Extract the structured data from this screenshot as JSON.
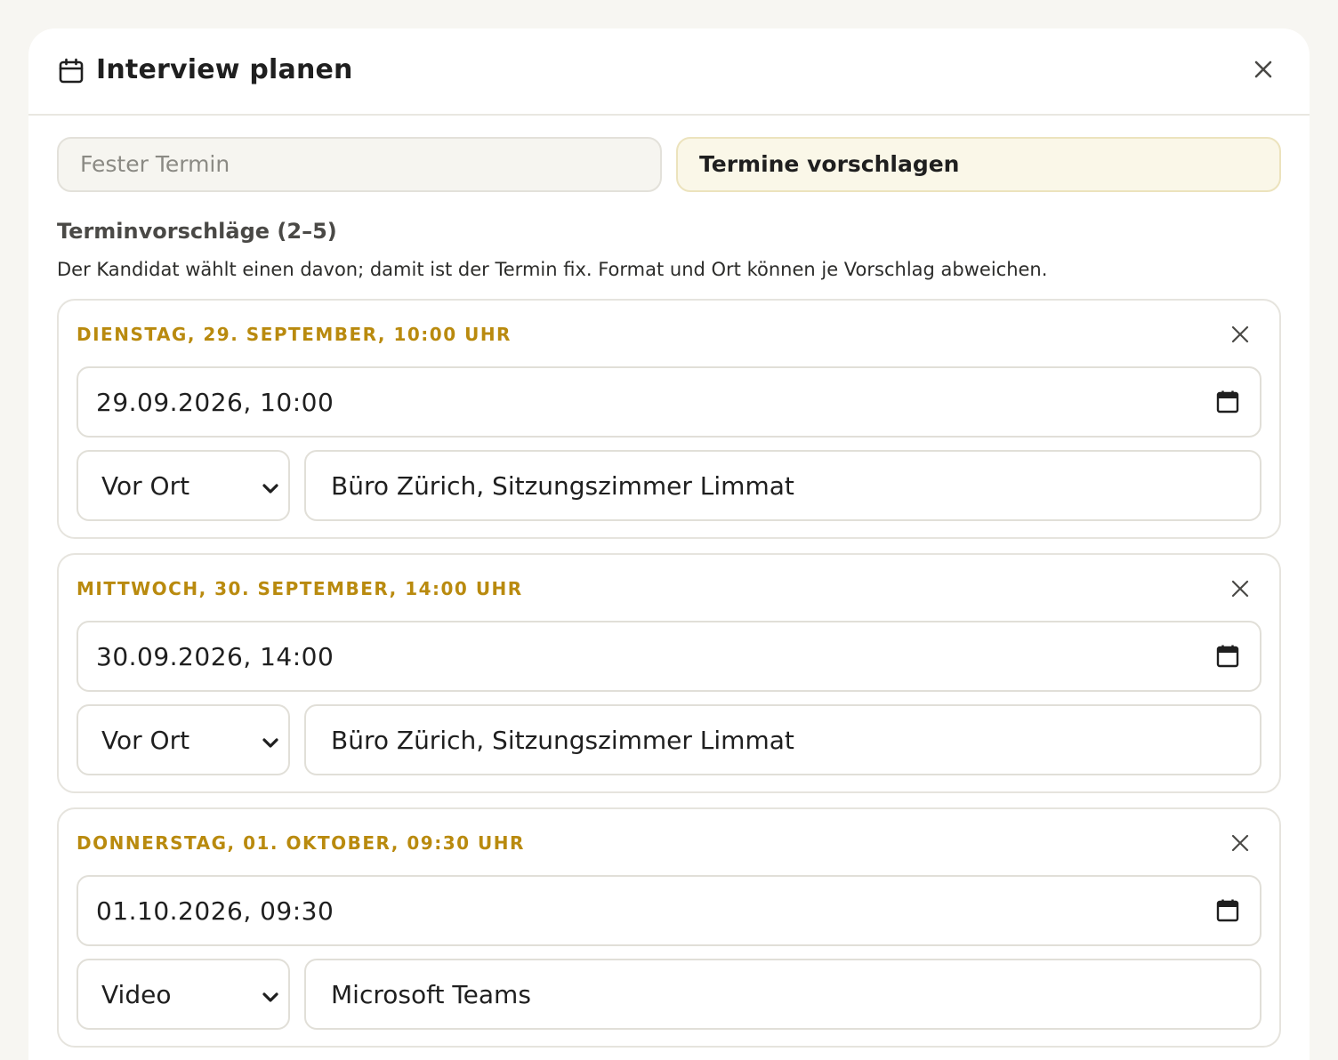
{
  "dialog": {
    "title": "Interview planen",
    "icon": "calendar-icon",
    "close_icon": "close-icon"
  },
  "mode_toggle": {
    "options": [
      {
        "label": "Fester Termin",
        "active": false
      },
      {
        "label": "Termine vorschlagen",
        "active": true
      }
    ]
  },
  "proposals_section": {
    "title": "Terminvorschläge (2–5)",
    "hint": "Der Kandidat wählt einen davon; damit ist der Termin fix. Format und Ort können je Vorschlag abweichen."
  },
  "proposals": [
    {
      "heading": "Dienstag, 29. September, 10:00 Uhr",
      "datetime_value": "29.09.2026, 10:00",
      "format_value": "Vor Ort",
      "location_value": "Büro Zürich, Sitzungszimmer Limmat"
    },
    {
      "heading": "Mittwoch, 30. September, 14:00 Uhr",
      "datetime_value": "30.09.2026, 14:00",
      "format_value": "Vor Ort",
      "location_value": "Büro Zürich, Sitzungszimmer Limmat"
    },
    {
      "heading": "Donnerstag, 01. Oktober, 09:30 Uhr",
      "datetime_value": "01.10.2026, 09:30",
      "format_value": "Video",
      "location_value": "Microsoft Teams"
    }
  ],
  "colors": {
    "accent_gold": "#b98a0e",
    "active_toggle_bg": "#faf7e8",
    "page_bg": "#f7f6f2"
  }
}
